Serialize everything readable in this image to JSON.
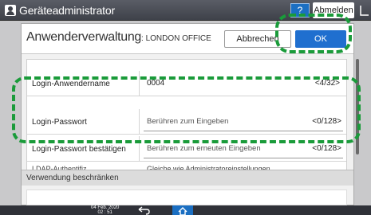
{
  "header": {
    "title": "Geräteadministrator",
    "help_label": "?",
    "logout_label": "Abmelden"
  },
  "page": {
    "title": "Anwenderverwaltung",
    "subtitle": ": LONDON OFFICE",
    "cancel_label": "Abbrechen",
    "ok_label": "OK"
  },
  "form": {
    "login_name": {
      "label": "Login-Anwendername",
      "value": "0004",
      "counter": "<4/32>"
    },
    "password": {
      "label": "Login-Passwort",
      "placeholder": "Berühren zum Eingeben",
      "counter": "<0/128>"
    },
    "password_confirm": {
      "label": "Login-Passwort bestätigen",
      "placeholder": "Berühren zum erneuten Eingeben",
      "counter": "<0/128>"
    },
    "ldap": {
      "label": "LDAP-Authentifiz.",
      "value": "Gleiche wie Administratoreinstellungen"
    }
  },
  "section": {
    "restrict_label": "Verwendung beschränken"
  },
  "footer": {
    "date": "04 Feb. 2020",
    "time": "02 : 51"
  },
  "colors": {
    "accent": "#1f6fcf",
    "callout": "#1a9b3a",
    "topbar": "#3e4149"
  }
}
